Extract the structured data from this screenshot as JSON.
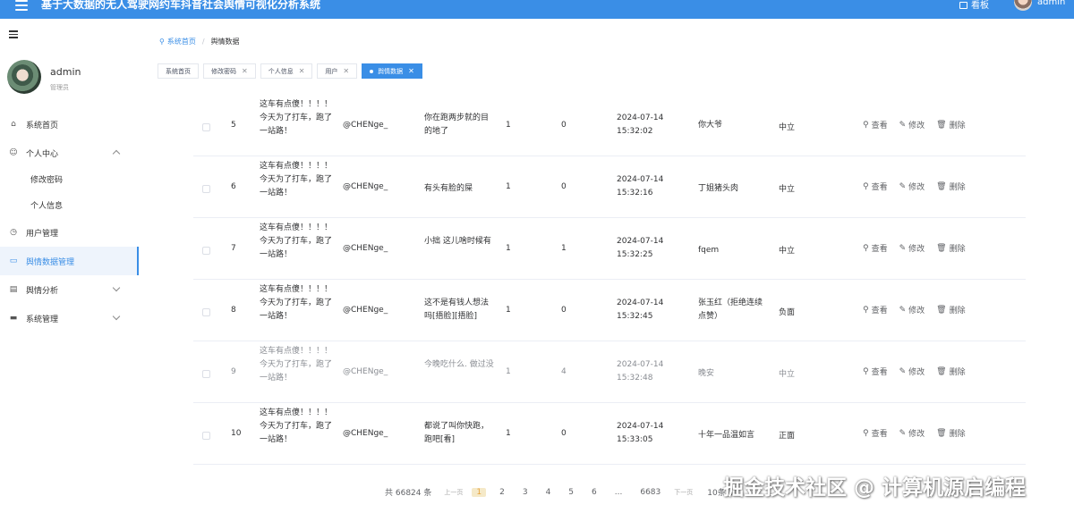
{
  "app": {
    "title": "基于大数据的无人驾驶网约车抖音社会舆情可视化分析系统",
    "board_label": "看板",
    "user_label": "admin"
  },
  "sidebar": {
    "username": "admin",
    "role": "管理员",
    "items": [
      {
        "label": "系统首页",
        "icon": "home-icon"
      },
      {
        "label": "个人中心",
        "icon": "user-icon"
      },
      {
        "label": "修改密码"
      },
      {
        "label": "个人信息"
      },
      {
        "label": "用户管理",
        "icon": "clock-icon"
      },
      {
        "label": "舆情数据管理",
        "icon": "chat-icon"
      },
      {
        "label": "舆情分析",
        "icon": "chart-icon"
      },
      {
        "label": "系统管理",
        "icon": "monitor-icon"
      }
    ]
  },
  "breadcrumb": {
    "home": "系统首页",
    "current": "舆情数据"
  },
  "tabs": [
    {
      "label": "系统首页"
    },
    {
      "label": "修改密码"
    },
    {
      "label": "个人信息"
    },
    {
      "label": "用户"
    },
    {
      "label": "舆情数据"
    }
  ],
  "actions": {
    "view": "查看",
    "edit": "修改",
    "delete": "删除"
  },
  "rows": [
    {
      "idx": "5",
      "title": "这车有点傻！！！！ 今天为了打车，跑了一站路！",
      "nick": "@CHENge_",
      "content": "你在跑两步就的目的地了",
      "likes": "1",
      "replies": "0",
      "time": "2024-07-14 15:32:02",
      "author": "你大爷",
      "sentiment": "中立"
    },
    {
      "idx": "6",
      "title": "这车有点傻！！！！ 今天为了打车，跑了一站路！",
      "nick": "@CHENge_",
      "content": "有头有脸的屎",
      "likes": "1",
      "replies": "0",
      "time": "2024-07-14 15:32:16",
      "author": "丁姐猪头肉",
      "sentiment": "中立"
    },
    {
      "idx": "7",
      "title": "这车有点傻！！！！ 今天为了打车，跑了一站路！",
      "nick": "@CHENge_",
      "content": "小拙 这儿啥时候有",
      "likes": "1",
      "replies": "1",
      "time": "2024-07-14 15:32:25",
      "author": "fqem",
      "sentiment": "中立"
    },
    {
      "idx": "8",
      "title": "这车有点傻！！！！ 今天为了打车，跑了一站路！",
      "nick": "@CHENge_",
      "content": "这不是有钱人想法吗[捂脸][捂脸]",
      "likes": "1",
      "replies": "0",
      "time": "2024-07-14 15:32:45",
      "author": "张玉红（拒绝连续点赞）",
      "sentiment": "负面"
    },
    {
      "idx": "9",
      "title": "这车有点傻！！！！ 今天为了打车，跑了一站路！",
      "nick": "@CHENge_",
      "content": "今晚吃什么. 做过没",
      "likes": "1",
      "replies": "4",
      "time": "2024-07-14 15:32:48",
      "author": "晚安",
      "sentiment": "中立"
    },
    {
      "idx": "10",
      "title": "这车有点傻！！！！ 今天为了打车，跑了一站路！",
      "nick": "@CHENge_",
      "content": "都说了叫你快跑，跑吧[看]",
      "likes": "1",
      "replies": "0",
      "time": "2024-07-14 15:33:05",
      "author": "十年一品温如言",
      "sentiment": "正面"
    }
  ],
  "pagination": {
    "total": "共 66824 条",
    "prev": "上一页",
    "pages": [
      "1",
      "2",
      "3",
      "4",
      "5",
      "6",
      "...",
      "6683"
    ],
    "next": "下一页",
    "page_size": "10条/页"
  },
  "watermark": "掘金技术社区 @ 计算机源启编程",
  "colors": {
    "primary": "#3a8ee6",
    "active_bg": "#eef4fc",
    "current_page": "#e6a23c"
  }
}
